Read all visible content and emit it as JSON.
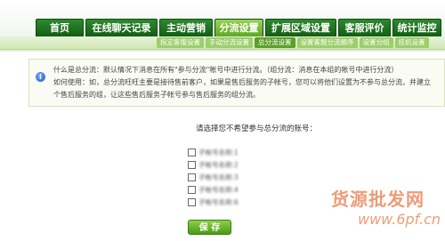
{
  "nav": {
    "tabs": [
      {
        "label": "首页"
      },
      {
        "label": "在线聊天记录"
      },
      {
        "label": "主动营销"
      },
      {
        "label": "分流设置"
      },
      {
        "label": "扩展区域设置"
      },
      {
        "label": "客服评价"
      },
      {
        "label": "统计监控"
      }
    ],
    "subtabs": [
      {
        "label": "指定客服设置"
      },
      {
        "label": "手动分流设置"
      },
      {
        "label": "总分流设置"
      },
      {
        "label": "设置客服分流顺序"
      },
      {
        "label": "设置分组"
      },
      {
        "label": "挂机设置"
      }
    ]
  },
  "info": {
    "line1": "什么是总分流：默认情况下消息在所有\"参与分流\"帐号中进行分流。（组分流：消息在本组的帐号中进行分流）",
    "line2": "如何使用：如，总分流旺旺主要是接待售前客户，如果是售后服务的子帐号，您可以将他们设置为不参与总分流，并建立",
    "line3": "个售后服务的组，让这些售后服务子帐号参与售后服务的组分流。"
  },
  "form": {
    "prompt": "请选择您不希望参与总分流的账号：",
    "accounts": [
      {
        "label": "子帐号名称:1"
      },
      {
        "label": "子帐号名称:2"
      },
      {
        "label": "子帐号名称:3"
      },
      {
        "label": "子帐号名称:4"
      },
      {
        "label": "子帐号名称:6"
      }
    ],
    "save_label": "保 存"
  },
  "watermark": {
    "line1": "货源批发网",
    "line2": "www.6pf.cn"
  }
}
